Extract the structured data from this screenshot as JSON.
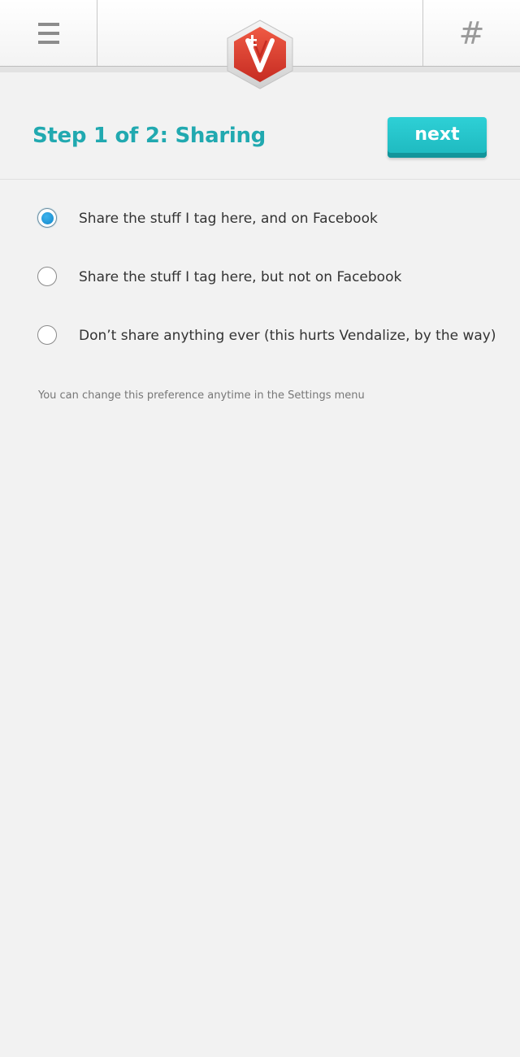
{
  "header": {
    "menu_icon": "hamburger-menu-icon",
    "hash_label": "#",
    "logo": "vendalize-logo",
    "logo_color": "#d8352a"
  },
  "step": {
    "title": "Step 1 of 2: Sharing",
    "next_label": "next",
    "title_color": "#21a9b0",
    "button_color": "#24c2c8"
  },
  "sharing": {
    "options": [
      {
        "label": "Share the stuff I tag here, and on Facebook",
        "selected": true
      },
      {
        "label": "Share the stuff I tag here, but not on Facebook",
        "selected": false
      },
      {
        "label": "Don’t share anything ever (this hurts Vendalize, by the way)",
        "selected": false
      }
    ],
    "hint": "You can change this preference anytime in the Settings menu"
  }
}
